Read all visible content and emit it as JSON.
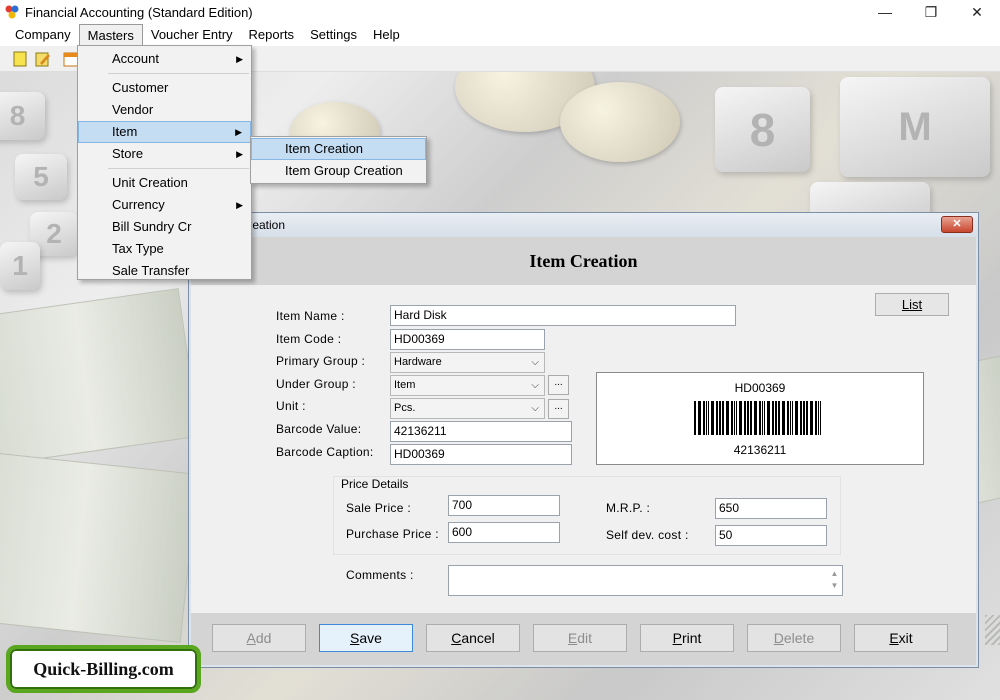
{
  "app": {
    "title": "Financial Accounting (Standard Edition)",
    "controls": {
      "minimize": "—",
      "maximize": "❐",
      "close": "✕"
    }
  },
  "menubar": {
    "items": [
      "Company",
      "Masters",
      "Voucher Entry",
      "Reports",
      "Settings",
      "Help"
    ]
  },
  "masters_menu": {
    "account": "Account",
    "customer": "Customer",
    "vendor": "Vendor",
    "item": "Item",
    "store": "Store",
    "unit_creation": "Unit Creation",
    "currency": "Currency",
    "bill_sundry": "Bill Sundry Cr",
    "tax_type": "Tax Type",
    "sale_transfer": "Sale Transfer"
  },
  "item_submenu": {
    "item_creation": "Item Creation",
    "item_group_creation": "Item Group Creation"
  },
  "dialog": {
    "title": "Item Creation",
    "heading": "Item Creation",
    "list_button": "List",
    "labels": {
      "item_name": "Item Name :",
      "item_code": "Item Code :",
      "primary_group": "Primary Group :",
      "under_group": "Under Group :",
      "unit": "Unit :",
      "barcode_value": "Barcode Value:",
      "barcode_caption": "Barcode Caption:"
    },
    "values": {
      "item_name": "Hard Disk",
      "item_code": "HD00369",
      "primary_group": "Hardware",
      "under_group": "Item",
      "unit": "Pcs.",
      "barcode_value": "42136211",
      "barcode_caption": "HD00369"
    },
    "ellipsis": "...",
    "barcode": {
      "caption": "HD00369",
      "value": "42136211"
    },
    "price_details": {
      "title": "Price Details",
      "sale_price_label": "Sale Price :",
      "sale_price": "700",
      "purchase_price_label": "Purchase Price :",
      "purchase_price": "600",
      "mrp_label": "M.R.P. :",
      "mrp": "650",
      "self_dev_cost_label": "Self dev. cost :",
      "self_dev_cost": "50"
    },
    "comments_label": "Comments :",
    "comments": "",
    "buttons": {
      "add_first": "A",
      "add_rest": "dd",
      "save_first": "S",
      "save_rest": "ave",
      "cancel_first": "C",
      "cancel_rest": "ancel",
      "edit_first": "E",
      "edit_rest": "dit",
      "print_first": "P",
      "print_rest": "rint",
      "delete_first": "D",
      "delete_rest": "elete",
      "exit_first": "E",
      "exit_rest": "xit"
    }
  },
  "badge": "Quick-Billing.com",
  "colors": {
    "highlight": "#c5ddf3",
    "badge_border": "#5aa61e",
    "dialog_close": "#c8472f"
  }
}
